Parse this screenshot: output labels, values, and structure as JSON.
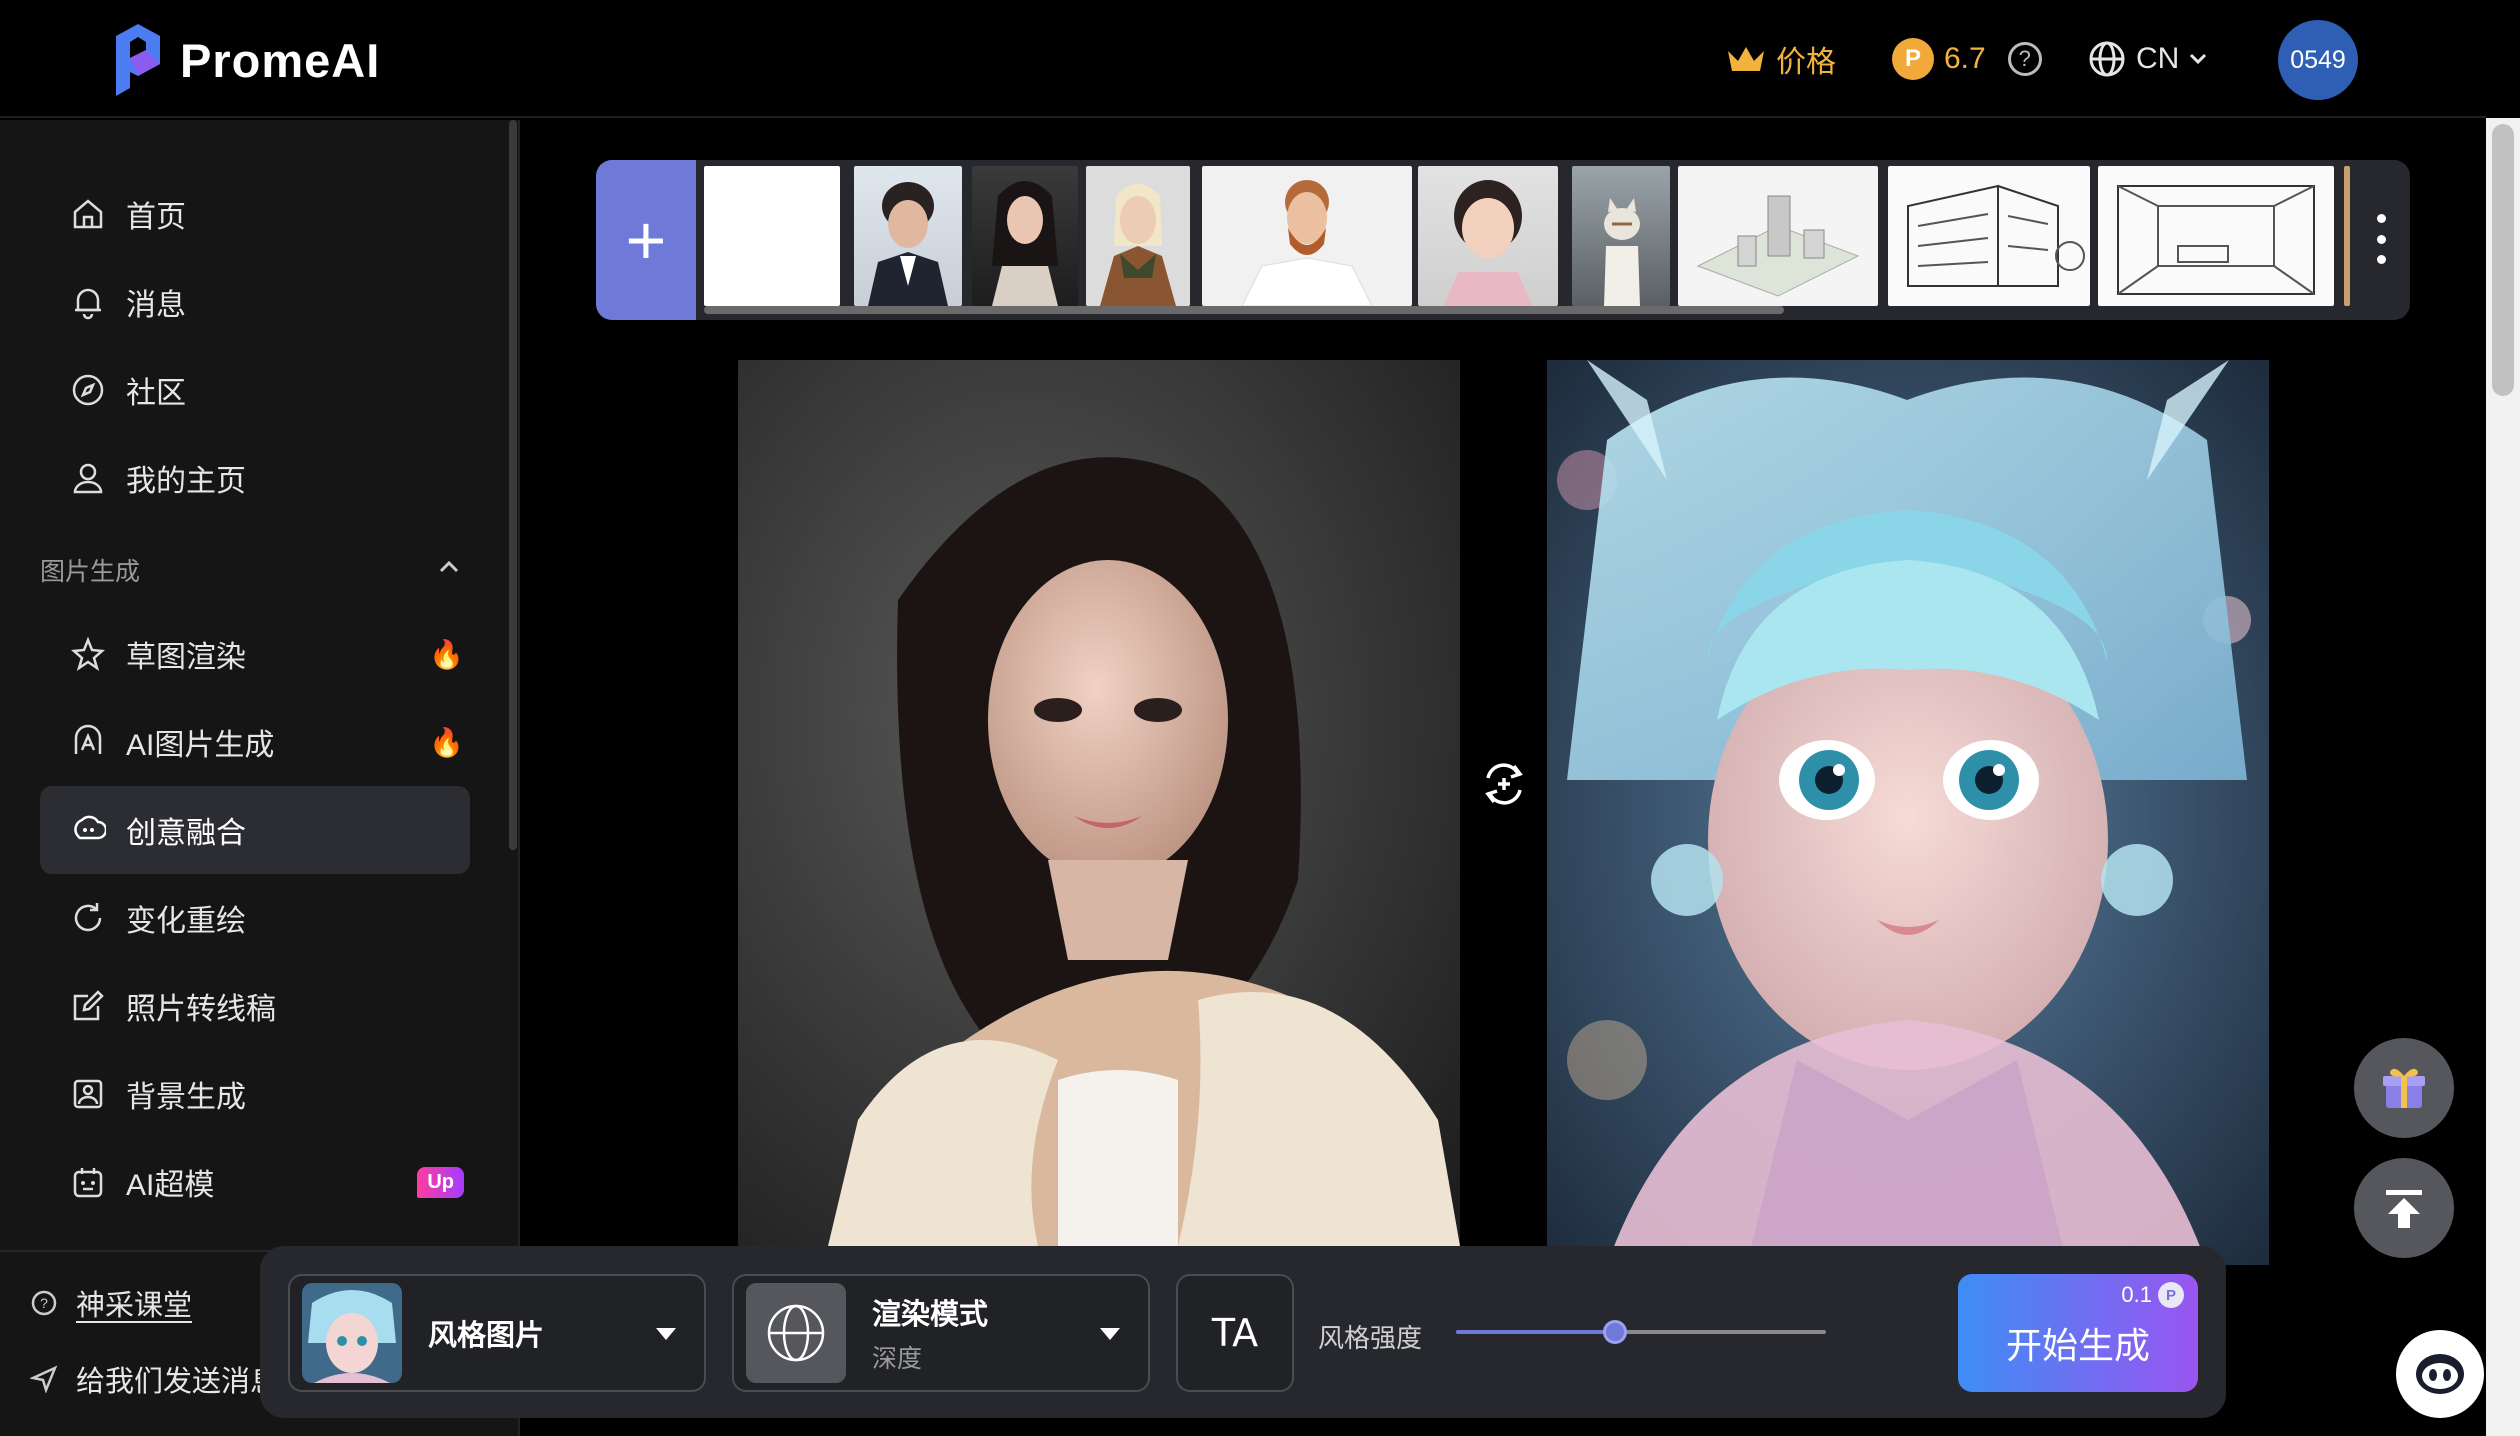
{
  "header": {
    "brand": "PromeAI",
    "price_label": "价格",
    "credits": "6.7",
    "help_glyph": "?",
    "language": "CN",
    "user_badge": "0549",
    "accent_color": "#f1b33d"
  },
  "sidebar": {
    "items": [
      {
        "label": "首页",
        "icon": "home-icon"
      },
      {
        "label": "消息",
        "icon": "bell-icon"
      },
      {
        "label": "社区",
        "icon": "compass-icon"
      },
      {
        "label": "我的主页",
        "icon": "user-icon"
      }
    ],
    "section_title": "图片生成",
    "tools": [
      {
        "label": "草图渲染",
        "icon": "sketch-icon",
        "badge": "fire"
      },
      {
        "label": "AI图片生成",
        "icon": "ai-image-icon",
        "badge": "fire"
      },
      {
        "label": "创意融合",
        "icon": "fusion-icon",
        "active": true
      },
      {
        "label": "变化重绘",
        "icon": "refresh-icon"
      },
      {
        "label": "照片转线稿",
        "icon": "edit-icon"
      },
      {
        "label": "背景生成",
        "icon": "image-icon"
      },
      {
        "label": "AI超模",
        "icon": "model-icon",
        "badge": "Up"
      }
    ],
    "bottom": {
      "course": "神采课堂",
      "feedback": "给我们发送消息"
    }
  },
  "toolbar": {
    "style_label": "风格图片",
    "render_label": "渲染模式",
    "render_value": "深度",
    "strength_label": "风格强度",
    "strength_value": 0.43,
    "generate_label": "开始生成",
    "generate_cost": "0.1",
    "text_icon_glyph": "TA"
  },
  "thumbstrip": {
    "add_glyph": "+"
  }
}
